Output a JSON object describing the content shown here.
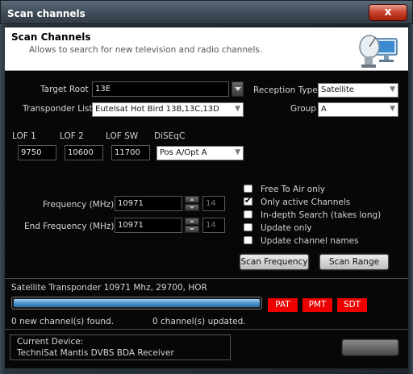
{
  "window": {
    "title": "Scan channels",
    "close": "x"
  },
  "header": {
    "title": "Scan Channels",
    "subtitle": "Allows to search for new television and radio channels.",
    "icon": "satellite-dish-icon"
  },
  "form": {
    "target_root": {
      "label": "Target Root",
      "value": "13E"
    },
    "transponder_list": {
      "label": "Transponder List",
      "value": "Eutelsat Hot Bird 13B,13C,13D"
    },
    "reception_type": {
      "label": "Reception Type",
      "value": "Satellite"
    },
    "group": {
      "label": "Group",
      "value": "A"
    },
    "lof1": {
      "label": "LOF 1",
      "value": "9750"
    },
    "lof2": {
      "label": "LOF 2",
      "value": "10600"
    },
    "lofsw": {
      "label": "LOF SW",
      "value": "11700"
    },
    "diseqc": {
      "label": "DiSEqC",
      "value": "Pos A/Opt A"
    },
    "frequency": {
      "label": "Frequency (MHz)",
      "value": "10971",
      "small": "14"
    },
    "end_frequency": {
      "label": "End  Frequency (MHz)",
      "value": "10971",
      "small": "14"
    }
  },
  "options": [
    {
      "label": "Free To Air only",
      "checked": false
    },
    {
      "label": "Only active Channels",
      "checked": true
    },
    {
      "label": "In-depth Search (takes long)",
      "checked": false
    },
    {
      "label": "Update only",
      "checked": false
    },
    {
      "label": "Update channel names",
      "checked": false
    }
  ],
  "buttons": {
    "scan_frequency": "Scan Frequency",
    "scan_range": "Scan Range"
  },
  "status": {
    "transponder": "Satellite Transponder 10971 Mhz, 29700, HOR",
    "progress": 1.0,
    "badges": [
      "PAT",
      "PMT",
      "SDT"
    ],
    "new_found": "0 new channel(s) found.",
    "updated": "0 channel(s) updated."
  },
  "device": {
    "label": "Current Device:",
    "name": "TechniSat Mantis DVBS BDA Receiver"
  },
  "colors": {
    "accent": "#ee0000",
    "progress": "#4f95d0",
    "titlebar": "#3d4a56"
  }
}
